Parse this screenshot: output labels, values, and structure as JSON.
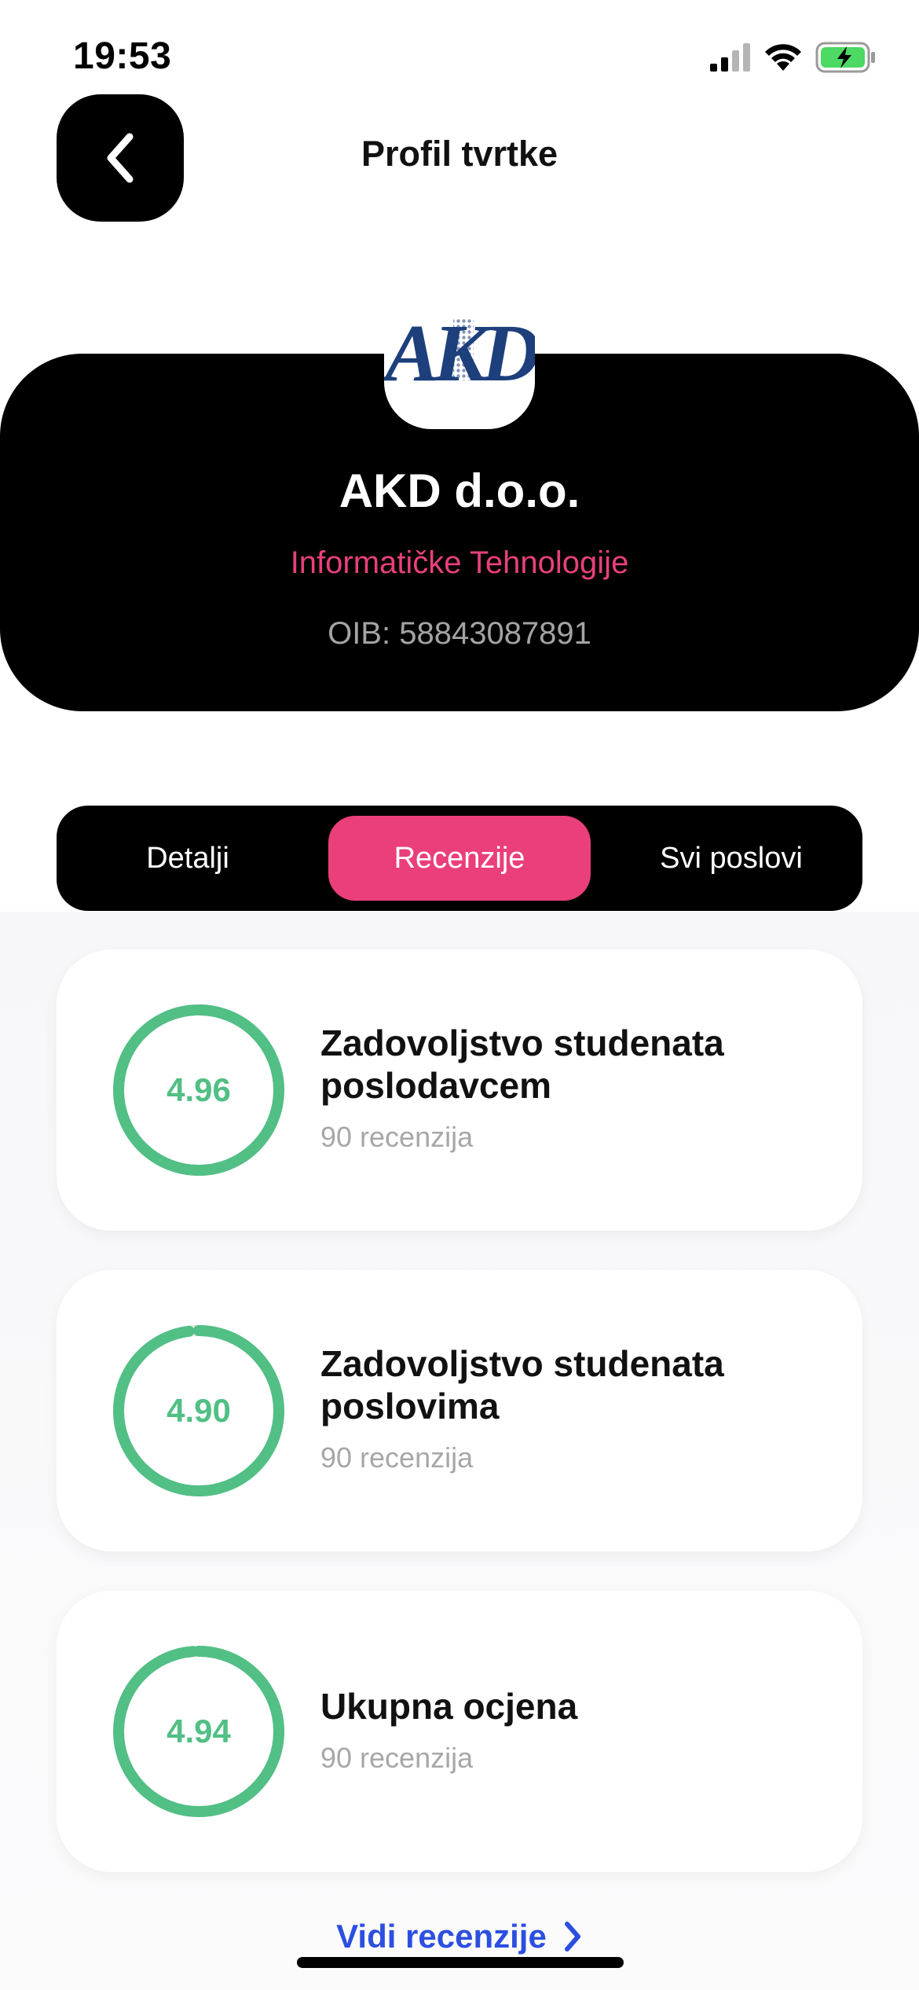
{
  "status_bar": {
    "time": "19:53"
  },
  "header": {
    "title": "Profil tvrtke"
  },
  "company": {
    "logo_text": "AKD",
    "name": "AKD d.o.o.",
    "category": "Informatičke Tehnologije",
    "oib": "OIB: 58843087891"
  },
  "tabs": [
    {
      "label": "Detalji",
      "active": false
    },
    {
      "label": "Recenzije",
      "active": true
    },
    {
      "label": "Svi poslovi",
      "active": false
    }
  ],
  "ratings": [
    {
      "value": "4.96",
      "score": 4.96,
      "max": 5,
      "title": "Zadovoljstvo studenata poslodavcem",
      "count": "90 recenzija"
    },
    {
      "value": "4.90",
      "score": 4.9,
      "max": 5,
      "title": "Zadovoljstvo studenata poslovima",
      "count": "90 recenzija"
    },
    {
      "value": "4.94",
      "score": 4.94,
      "max": 5,
      "title": "Ukupna ocjena",
      "count": "90 recenzija"
    }
  ],
  "see_reviews": {
    "label": "Vidi recenzije"
  },
  "colors": {
    "accent": "#ea3f7a",
    "rating": "#52bf85",
    "link": "#2c4fe0",
    "battery": "#4cd964"
  }
}
